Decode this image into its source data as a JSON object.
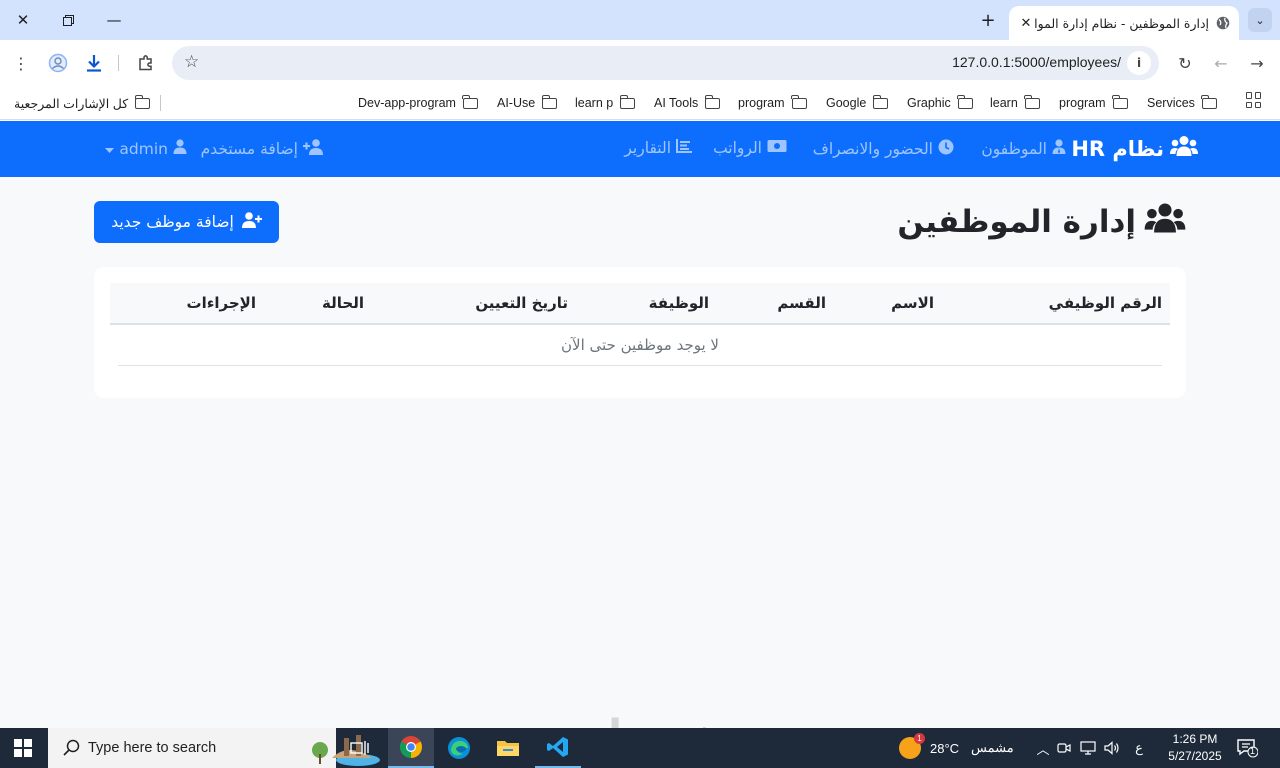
{
  "browser": {
    "tab_title": "إدارة الموظفين - نظام إدارة الموار",
    "url": "127.0.0.1:5000/employees/",
    "bookmarks": [
      "Services",
      "program",
      "learn",
      "Graphic",
      "Google",
      "program",
      "AI Tools",
      "learn p",
      "AI-Use",
      "Dev-app-program"
    ],
    "all_bookmarks": "كل الإشارات المرجعية"
  },
  "navbar": {
    "brand": "نظام HR",
    "items": [
      "الموظفون",
      "الحضور والانصراف",
      "الرواتب",
      "التقارير"
    ],
    "add_user": "إضافة مستخدم",
    "user": "admin"
  },
  "page": {
    "title": "إدارة الموظفين",
    "add_button": "إضافة موظف جديد",
    "table": {
      "columns": [
        "الرقم الوظيفي",
        "الاسم",
        "القسم",
        "الوظيفة",
        "تاريخ التعيين",
        "الحالة",
        "الإجراءات"
      ],
      "empty_message": "لا يوجد موظفين حتى الآن"
    }
  },
  "taskbar": {
    "search_placeholder": "Type here to search",
    "weather_temp": "28°C",
    "weather_desc": "مشمس",
    "weather_badge": "1",
    "lang": "ع",
    "time": "1:26 PM",
    "date": "5/27/2025",
    "notif_count": "1",
    "watermark": "خمسات"
  },
  "colors": {
    "primary": "#0d6efd",
    "tabstrip": "#d3e3fd",
    "taskbar": "#1e2a3a"
  }
}
